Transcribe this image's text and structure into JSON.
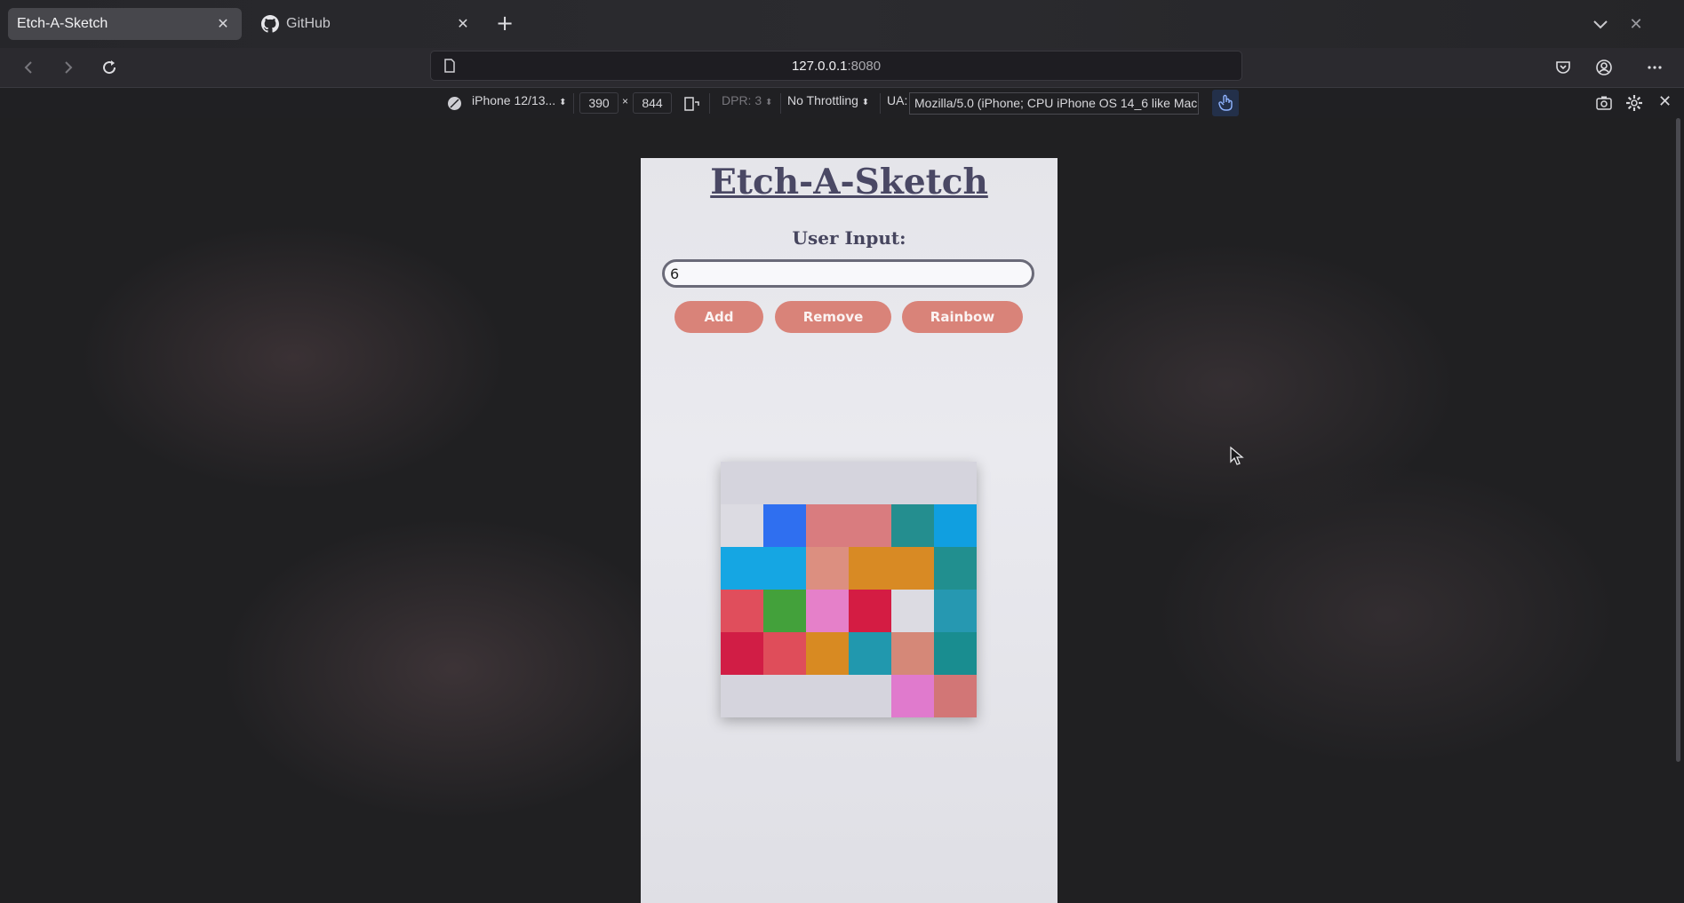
{
  "browser": {
    "tabs": [
      {
        "title": "Etch-A-Sketch",
        "active": true
      },
      {
        "title": "GitHub",
        "active": false
      }
    ],
    "url": {
      "host": "127.0.0.1",
      "port": ":8080"
    }
  },
  "rdm": {
    "device": "iPhone 12/13...",
    "width": "390",
    "times": "×",
    "height": "844",
    "dpr": "DPR: 3",
    "throttling": "No Throttling",
    "ua_label": "UA:",
    "ua_value": "Mozilla/5.0 (iPhone; CPU iPhone OS 14_6 like Mac"
  },
  "app": {
    "title": "Etch-A-Sketch",
    "input_label": "User Input:",
    "input_value": "6",
    "buttons": {
      "add": "Add",
      "remove": "Remove",
      "rainbow": "Rainbow"
    },
    "grid_size": 6,
    "grid_colors": [
      [
        "#d5d4dd",
        "#d5d4dd",
        "#d5d4dd",
        "#d5d4dd",
        "#d5d4dd",
        "#d5d4dd"
      ],
      [
        "#dcdbe2",
        "#2f6ff0",
        "#d97c7f",
        "#d97c7f",
        "#248e8f",
        "#109fe0"
      ],
      [
        "#15a6e3",
        "#15a6e3",
        "#dc8f80",
        "#d88a24",
        "#d88a24",
        "#218f8f"
      ],
      [
        "#e04e5c",
        "#43a13b",
        "#e580c9",
        "#d41c43",
        "#dcdbe2",
        "#2698b1"
      ],
      [
        "#d11d45",
        "#df4d5a",
        "#d88a22",
        "#2198ae",
        "#d58878",
        "#198d90"
      ],
      [
        "#d5d4dd",
        "#d5d4dd",
        "#d5d4dd",
        "#d5d4dd",
        "#e07acd",
        "#d27676"
      ]
    ]
  },
  "colors": {
    "button_bg": "#d98379",
    "title": "#4a4864"
  }
}
